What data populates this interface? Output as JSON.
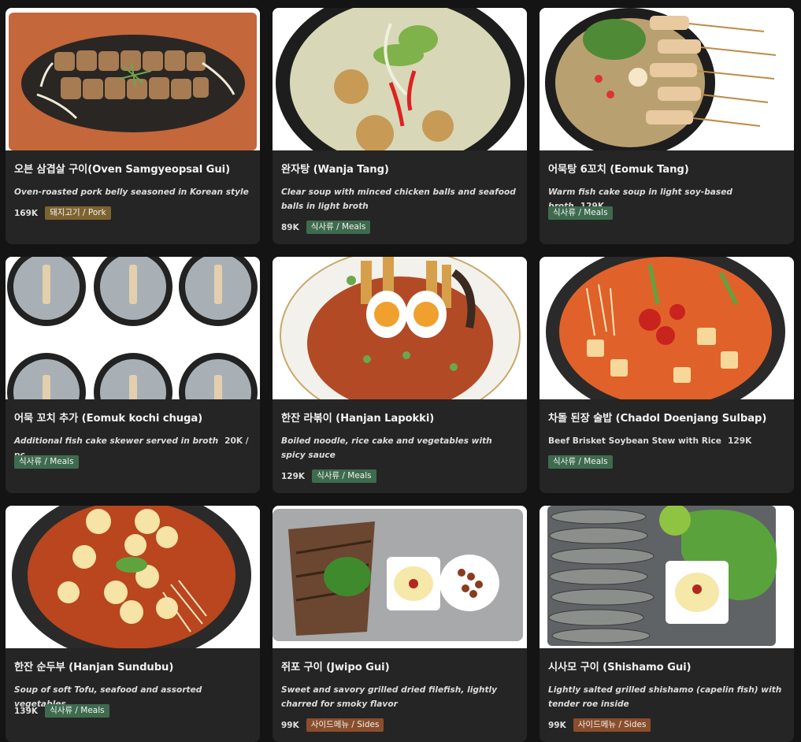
{
  "items": [
    {
      "title": "오븐 삼겹살 구이(Oven Samgyeopsal Gui)",
      "desc": "Oven-roasted pork belly seasoned in Korean style",
      "price": "169K",
      "badge": "돼지고기 / Pork",
      "badge_color": "#7d6330"
    },
    {
      "title": "완자탕 (Wanja Tang)",
      "desc": "Clear soup with minced chicken balls and seafood balls in light broth",
      "price": "89K",
      "badge": "식사류 / Meals",
      "badge_color": "#3e6b4e"
    },
    {
      "title": "어묵탕 6꼬치 (Eomuk Tang)",
      "desc": "Warm fish cake soup in light soy-based broth",
      "price": "129K",
      "badge": "식사류 / Meals",
      "badge_color": "#3e6b4e"
    },
    {
      "title": "어묵 꼬치 추가 (Eomuk kochi chuga)",
      "desc": "Additional fish cake skewer served in broth",
      "price": "20K / pc",
      "badge": "식사류 / Meals",
      "badge_color": "#3e6b4e"
    },
    {
      "title": "한잔 라볶이 (Hanjan Lapokki)",
      "desc": "Boiled noodle, rice cake and vegetables with spicy sauce",
      "price": "129K",
      "badge": "식사류 / Meals",
      "badge_color": "#3e6b4e"
    },
    {
      "title": "차돌 된장 술밥 (Chadol Doenjang Sulbap)",
      "desc": "Beef Brisket Soybean Stew with Rice",
      "price": "129K",
      "badge": "식사류 / Meals",
      "badge_color": "#3e6b4e"
    },
    {
      "title": "한잔 순두부 (Hanjan Sundubu)",
      "desc": "Soup of soft Tofu, seafood and assorted vegetables",
      "price": "139K",
      "badge": "식사류 / Meals",
      "badge_color": "#3e6b4e"
    },
    {
      "title": "쥐포 구이 (Jwipo Gui)",
      "desc": "Sweet and savory grilled dried filefish, lightly charred for smoky flavor",
      "price": "99K",
      "badge": "사이드메뉴 / Sides",
      "badge_color": "#8a4e2d"
    },
    {
      "title": "시사모 구이 (Shishamo Gui)",
      "desc": "Lightly salted grilled shishamo (capelin fish) with tender roe inside",
      "price": "99K",
      "badge": "사이드메뉴 / Sides",
      "badge_color": "#8a4e2d"
    }
  ]
}
